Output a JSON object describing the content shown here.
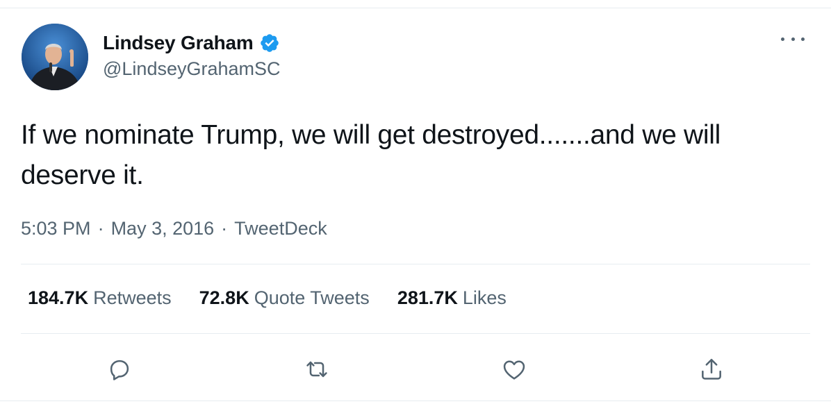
{
  "author": {
    "display_name": "Lindsey Graham",
    "handle": "@LindseyGrahamSC",
    "verified_icon": "verified-badge-icon",
    "avatar_icon": "avatar"
  },
  "tweet": {
    "text": "If we nominate Trump, we will get destroyed.......and we will deserve it.",
    "time": "5:03 PM",
    "separator": "·",
    "date": "May 3, 2016",
    "source": "TweetDeck"
  },
  "stats": [
    {
      "count": "184.7K",
      "label": "Retweets"
    },
    {
      "count": "72.8K",
      "label": "Quote Tweets"
    },
    {
      "count": "281.7K",
      "label": "Likes"
    }
  ],
  "actions": [
    {
      "icon": "reply-icon"
    },
    {
      "icon": "retweet-icon"
    },
    {
      "icon": "like-icon"
    },
    {
      "icon": "share-icon"
    }
  ],
  "more_icon": "more-options-icon",
  "colors": {
    "text": "#0f1419",
    "secondary": "#536471",
    "verified": "#1d9bf0",
    "divider": "#e6ecf0"
  }
}
